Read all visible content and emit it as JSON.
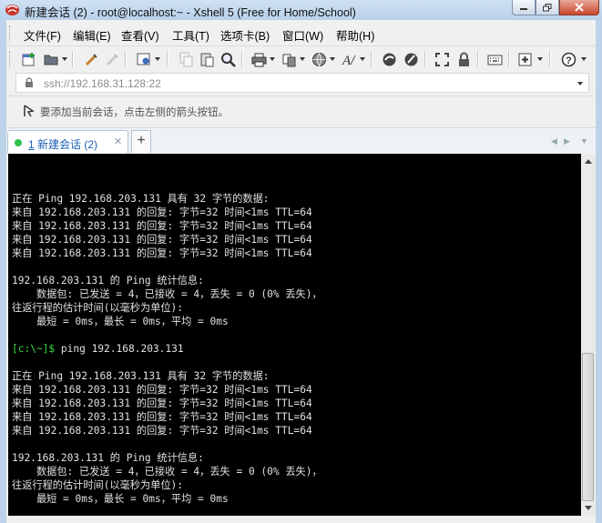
{
  "window": {
    "title": "新建会话 (2) - root@localhost:~ - Xshell 5 (Free for Home/School)"
  },
  "menu": [
    {
      "label": "文件(F)"
    },
    {
      "label": "编辑(E)"
    },
    {
      "label": "查看(V)"
    },
    {
      "label": "工具(T)"
    },
    {
      "label": "选项卡(B)"
    },
    {
      "label": "窗口(W)"
    },
    {
      "label": "帮助(H)"
    }
  ],
  "address": {
    "value": "ssh://192.168.31.128:22"
  },
  "hint": {
    "text": "要添加当前会话，点击左侧的箭头按钮。"
  },
  "tab": {
    "number": "1",
    "label": " 新建会话 (2)",
    "close": "✕"
  },
  "tab_add": "+",
  "terminal": {
    "prompt": "[c:\\~]$",
    "lines": [
      "正在 Ping 192.168.203.131 具有 32 字节的数据:",
      "来自 192.168.203.131 的回复: 字节=32 时间<1ms TTL=64",
      "来自 192.168.203.131 的回复: 字节=32 时间<1ms TTL=64",
      "来自 192.168.203.131 的回复: 字节=32 时间<1ms TTL=64",
      "来自 192.168.203.131 的回复: 字节=32 时间<1ms TTL=64",
      "",
      "192.168.203.131 的 Ping 统计信息:",
      "    数据包: 已发送 = 4，已接收 = 4，丢失 = 0 (0% 丢失)，",
      "往返行程的估计时间(以毫秒为单位):",
      "    最短 = 0ms，最长 = 0ms，平均 = 0ms",
      "",
      " ping 192.168.203.131",
      "",
      "正在 Ping 192.168.203.131 具有 32 字节的数据:",
      "来自 192.168.203.131 的回复: 字节=32 时间<1ms TTL=64",
      "来自 192.168.203.131 的回复: 字节=32 时间<1ms TTL=64",
      "来自 192.168.203.131 的回复: 字节=32 时间<1ms TTL=64",
      "来自 192.168.203.131 的回复: 字节=32 时间<1ms TTL=64",
      "",
      "192.168.203.131 的 Ping 统计信息:",
      "    数据包: 已发送 = 4，已接收 = 4，丢失 = 0 (0% 丢失)，",
      "往返行程的估计时间(以毫秒为单位):",
      "    最短 = 0ms，最长 = 0ms，平均 = 0ms"
    ]
  },
  "colors": {
    "terminal_bg": "#000000",
    "terminal_text": "#e0e0e0",
    "prompt": "#3cdc3c",
    "tab_text": "#1d5fb5",
    "session_dot": "#2ec24a",
    "title_bg": "#bcd3ea"
  },
  "icons": [
    "new-session-icon",
    "open-folder-icon",
    "connect-icon",
    "disconnect-icon",
    "properties-icon",
    "copy-icon",
    "paste-icon",
    "find-icon",
    "print-icon",
    "transfer-icon",
    "globe-icon",
    "font-icon",
    "xftp-icon",
    "xmanager-icon",
    "fullscreen-icon",
    "lock-icon",
    "keyboard-icon",
    "new-tab-icon",
    "help-icon"
  ]
}
